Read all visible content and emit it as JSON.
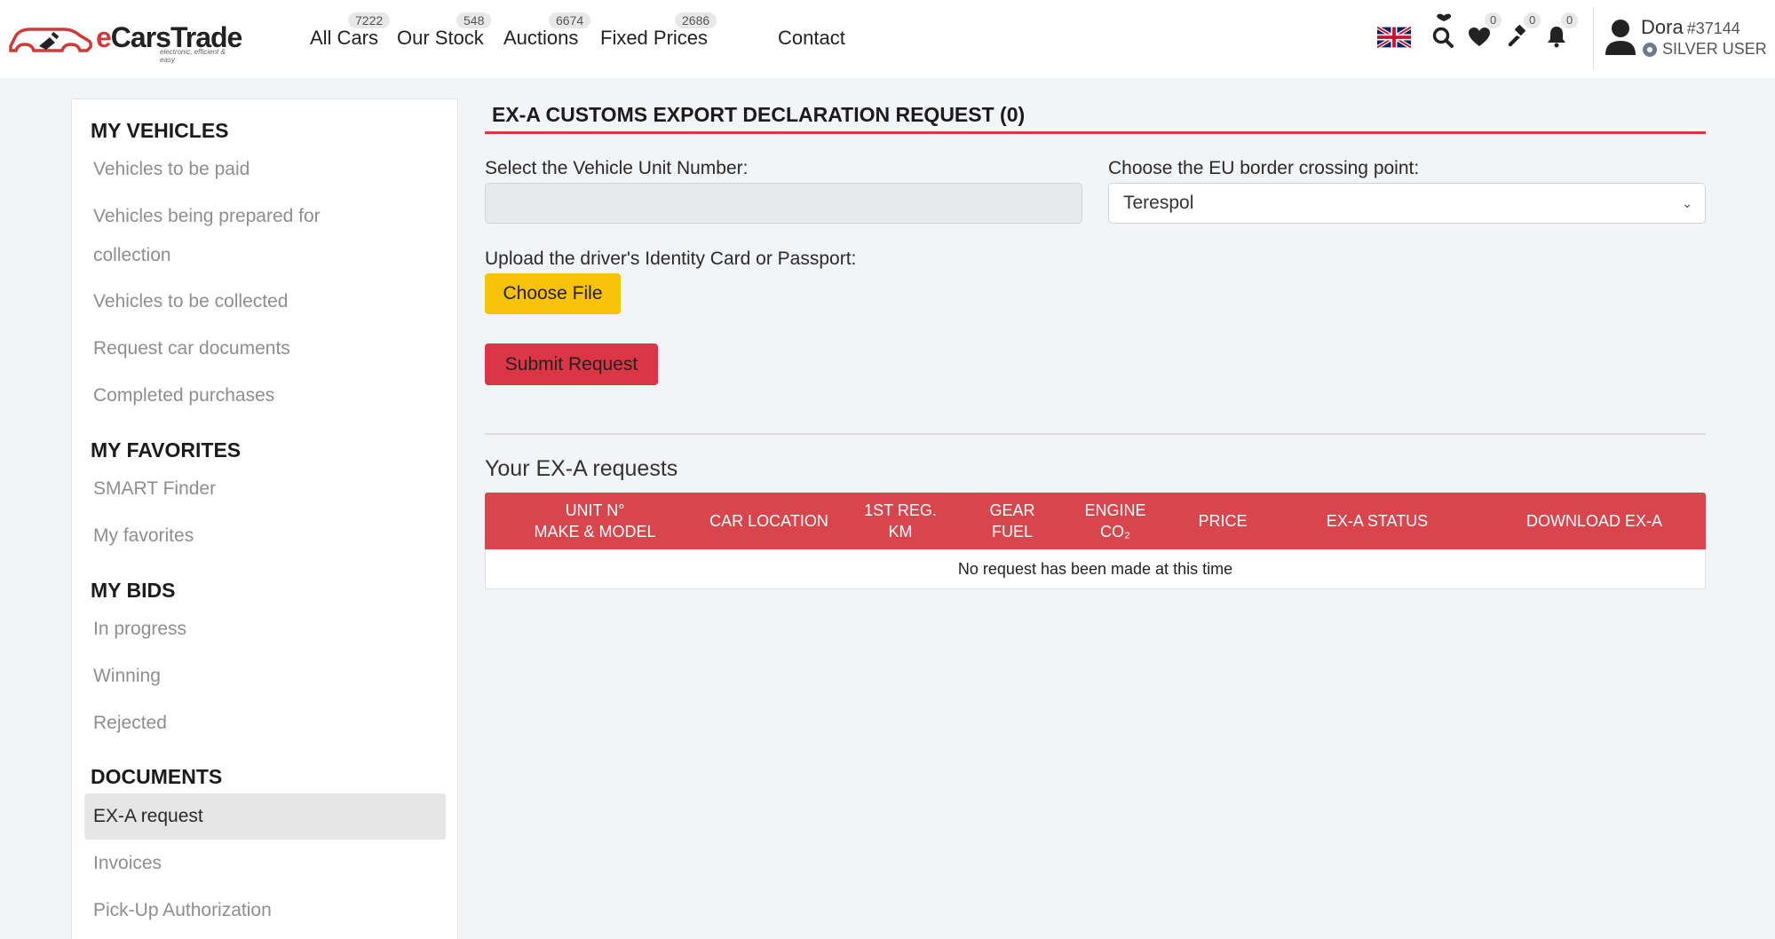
{
  "brand": {
    "name_prefix": "e",
    "name_rest": "CarsTrade",
    "tagline": "electronic, efficient & easy"
  },
  "nav": [
    {
      "label": "All Cars",
      "count": "7222"
    },
    {
      "label": "Our Stock",
      "count": "548"
    },
    {
      "label": "Auctions",
      "count": "6674"
    },
    {
      "label": "Fixed Prices",
      "count": "2686"
    },
    {
      "label": "Contact"
    }
  ],
  "header_icons": {
    "favorites_count": "0",
    "bids_count": "0",
    "notifications_count": "0"
  },
  "user": {
    "name": "Dora",
    "id": "#37144",
    "level": "SILVER USER"
  },
  "sidebar": {
    "sections": [
      {
        "title": "MY VEHICLES",
        "items": [
          "Vehicles to be paid",
          "Vehicles being prepared for",
          "collection",
          "Vehicles to be collected",
          "Request car documents",
          "Completed purchases"
        ]
      },
      {
        "title": "MY FAVORITES",
        "items": [
          "SMART Finder",
          "My favorites"
        ]
      },
      {
        "title": "MY BIDS",
        "items": [
          "In progress",
          "Winning",
          "Rejected"
        ]
      },
      {
        "title": "DOCUMENTS",
        "items": [
          "EX-A request",
          "Invoices",
          "Pick-Up Authorization"
        ]
      }
    ]
  },
  "form": {
    "title": "EX-A CUSTOMS EXPORT DECLARATION REQUEST (0)",
    "unit_label": "Select the Vehicle Unit Number:",
    "unit_value": "",
    "border_label": "Choose the EU border crossing point:",
    "border_value": "Terespol",
    "upload_label": "Upload the driver's Identity Card or Passport:",
    "choose_file": "Choose File",
    "submit": "Submit Request"
  },
  "requests": {
    "title": "Your EX-A requests",
    "columns": [
      [
        "UNIT N°",
        "MAKE & MODEL"
      ],
      [
        "CAR LOCATION"
      ],
      [
        "1ST REG.",
        "KM"
      ],
      [
        "GEAR",
        "FUEL"
      ],
      [
        "ENGINE",
        "CO₂"
      ],
      [
        "PRICE"
      ],
      [
        "EX-A STATUS"
      ],
      [
        "DOWNLOAD EX-A"
      ]
    ],
    "empty_message": "No request has been made at this time"
  },
  "colors": {
    "accent_red": "#d9454c",
    "button_yellow": "#f8c208",
    "button_red": "#dc3545"
  }
}
